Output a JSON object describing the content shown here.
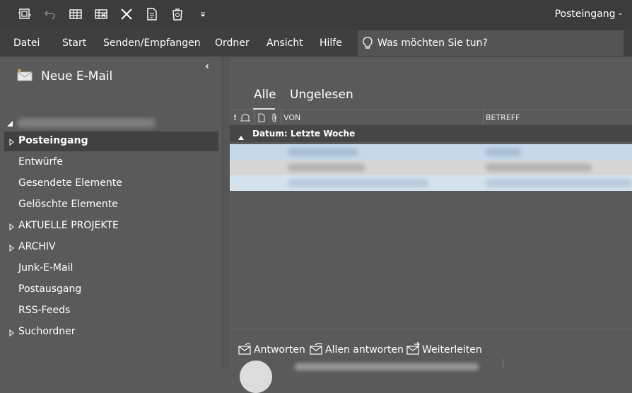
{
  "window": {
    "title": "Posteingang - "
  },
  "qat": [
    "send-receive-icon",
    "undo-icon",
    "table-icon",
    "table-delete-icon",
    "close-icon",
    "document-icon",
    "recycle-bin-icon",
    "customize-dropdown-icon"
  ],
  "menu": [
    "Datei",
    "Start",
    "Senden/Empfangen",
    "Ordner",
    "Ansicht",
    "Hilfe"
  ],
  "tellme": {
    "text": "Was möchten Sie tun?"
  },
  "sidebar": {
    "new_mail": "Neue E-Mail",
    "folders": [
      "Posteingang",
      "Entwürfe",
      "Gesendete Elemente",
      "Gelöschte Elemente",
      "AKTUELLE PROJEKTE",
      "ARCHIV",
      "Junk-E-Mail",
      "Postausgang",
      "RSS-Feeds",
      "Suchordner"
    ]
  },
  "main": {
    "tabs": [
      "Alle",
      "Ungelesen"
    ],
    "columns": {
      "flags": "!",
      "from": "VON",
      "subject": "BETREFF"
    },
    "group": "Datum: Letzte Woche"
  },
  "reading": {
    "actions": [
      "Antworten",
      "Allen antworten",
      "Weiterleiten"
    ]
  },
  "colors": {
    "titlebar": "#3c3c3c",
    "menubar": "#3f3f3f",
    "selected_folder": "#414141",
    "row_selected": "#c5d9ea",
    "row_unselected": "#d6d6d6"
  }
}
